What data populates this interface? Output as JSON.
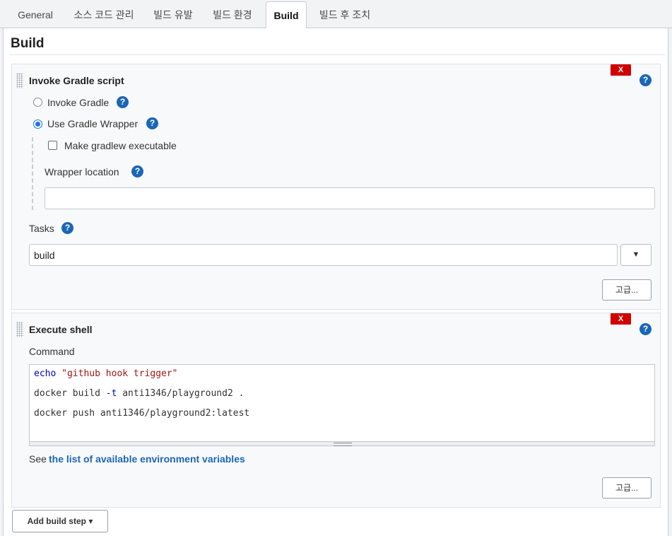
{
  "tabs": [
    {
      "label": "General",
      "active": false
    },
    {
      "label": "소스 코드 관리",
      "active": false
    },
    {
      "label": "빌드 유발",
      "active": false
    },
    {
      "label": "빌드 환경",
      "active": false
    },
    {
      "label": "Build",
      "active": true
    },
    {
      "label": "빌드 후 조치",
      "active": false
    }
  ],
  "section": {
    "title": "Build"
  },
  "gradle_step": {
    "title": "Invoke Gradle script",
    "delete_label": "X",
    "help_label": "?",
    "radio_invoke_gradle": "Invoke Gradle",
    "radio_use_wrapper": "Use Gradle Wrapper",
    "selected_option": "Use Gradle Wrapper",
    "make_executable_label": "Make gradlew executable",
    "make_executable_checked": false,
    "wrapper_location_label": "Wrapper location",
    "wrapper_location_value": "",
    "tasks_label": "Tasks",
    "tasks_value": "build",
    "tasks_dropdown_label": "▼",
    "advanced_label": "고급..."
  },
  "shell_step": {
    "title": "Execute shell",
    "delete_label": "X",
    "help_label": "?",
    "command_label": "Command",
    "command_lines": [
      {
        "keyword": "echo",
        "rest": " ",
        "string": "\"github hook trigger\""
      },
      {
        "keyword": "docker build ",
        "flag": "-t",
        "rest": " anti1346/playground2 ."
      },
      {
        "keyword": "docker push anti1346/playground2:latest"
      }
    ],
    "see_prefix": "See ",
    "env_link": "the list of available environment variables",
    "advanced_label": "고급..."
  },
  "add_step": {
    "label": "Add build step",
    "caret": "▾"
  },
  "colors": {
    "delete_red": "#d10000",
    "help_blue": "#1b66b5",
    "link_blue": "#1b66b5",
    "radio_blue": "#1a73e8"
  }
}
